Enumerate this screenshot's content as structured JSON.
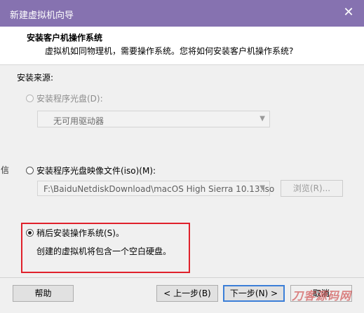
{
  "window": {
    "title": "新建虚拟机向导",
    "close_icon": "close-icon"
  },
  "header": {
    "title": "安装客户机操作系统",
    "subtitle": "虚拟机如同物理机，需要操作系统。您将如何安装客户机操作系统?"
  },
  "install_source": {
    "label": "安装来源:",
    "options": [
      {
        "label": "安装程序光盘(D):",
        "selected": false,
        "enabled": false,
        "dropdown_value": "无可用驱动器"
      },
      {
        "label": "安装程序光盘映像文件(iso)(M):",
        "selected": false,
        "enabled": true,
        "path_value": "F:\\BaiduNetdiskDownload\\macOS High Sierra 10.13.iso",
        "browse_label": "浏览(R)..."
      },
      {
        "label": "稍后安装操作系统(S)。",
        "selected": true,
        "enabled": true,
        "description": "创建的虚拟机将包含一个空白硬盘。"
      }
    ]
  },
  "left_edge_text": "信",
  "footer": {
    "help_label": "帮助",
    "back_label": "< 上一步(B)",
    "next_label": "下一步(N) >",
    "cancel_label": "取消"
  },
  "watermark": "刀客源码网",
  "colors": {
    "titlebar": "#8672b0",
    "highlight_border": "#e0212b",
    "primary_button_border": "#3c7fd8"
  }
}
